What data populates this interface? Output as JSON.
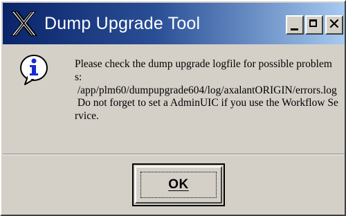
{
  "window": {
    "title": "Dump Upgrade Tool",
    "app_icon": "x-window-icon",
    "controls": {
      "minimize_icon": "minimize-icon",
      "maximize_icon": "maximize-icon",
      "close_glyph": "✕"
    }
  },
  "message": {
    "icon": "information-icon",
    "text": "Please check the dump upgrade logfile for possible problems:\n /app/plm60/dumpupgrade604/log/axalantORIGIN/errors.log\n Do not forget to set a AdminUIC if you use the Workflow Service."
  },
  "buttons": {
    "ok_label": "OK"
  },
  "colors": {
    "titlebar_start": "#0a246a",
    "titlebar_end": "#a6caf0",
    "face": "#d4d0c8",
    "info_icon_blue": "#1a2cd0"
  }
}
